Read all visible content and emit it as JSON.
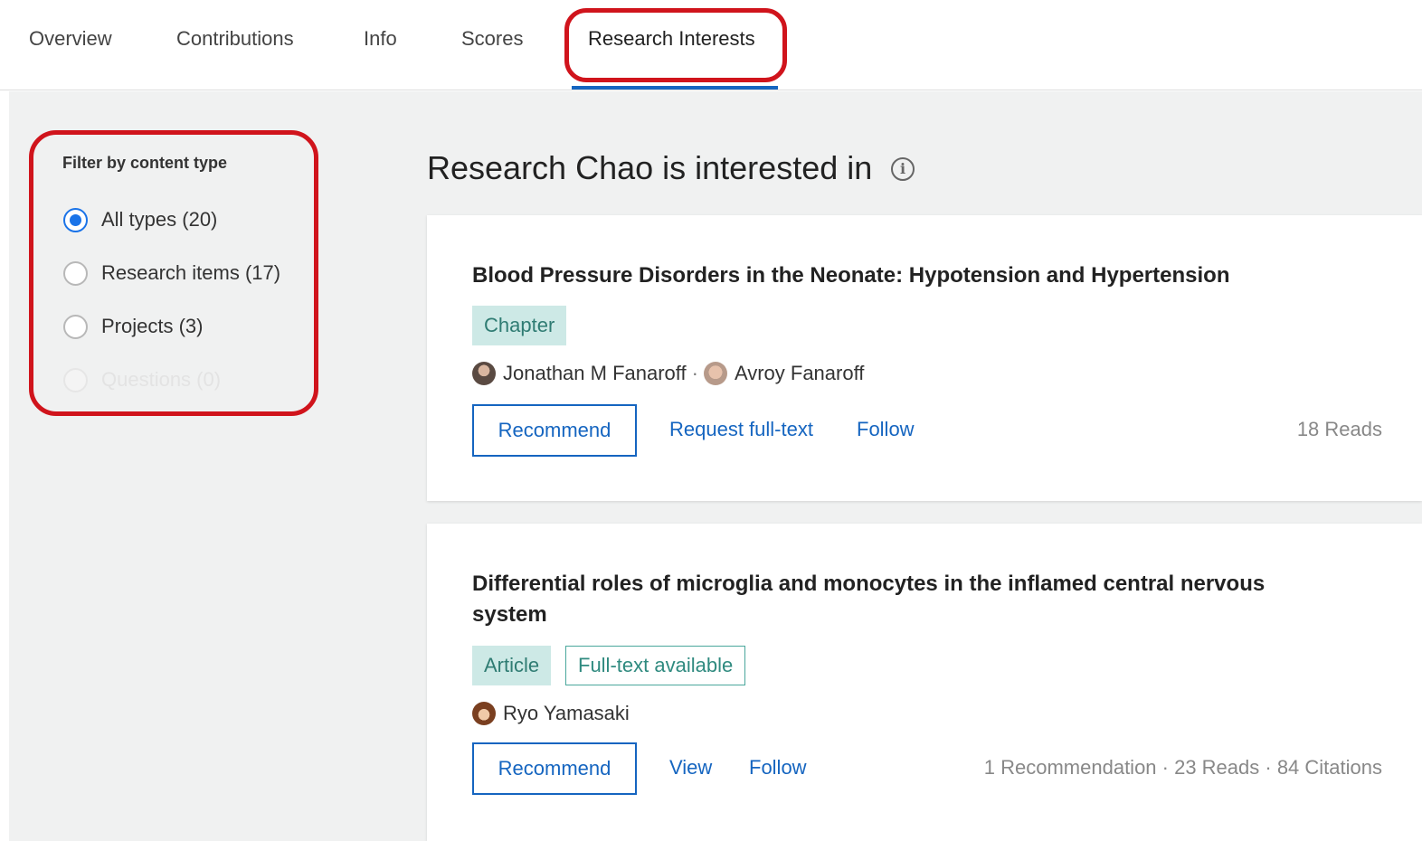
{
  "tabs": [
    {
      "label": "Overview"
    },
    {
      "label": "Contributions"
    },
    {
      "label": "Info"
    },
    {
      "label": "Scores"
    },
    {
      "label": "Research Interests"
    }
  ],
  "active_tab": "Research Interests",
  "accent_color": "#1565c0",
  "highlight_color": "#d0141c",
  "filter": {
    "heading": "Filter by content type",
    "options": [
      {
        "label": "All types (20)",
        "checked": true,
        "disabled": false
      },
      {
        "label": "Research items (17)",
        "checked": false,
        "disabled": false
      },
      {
        "label": "Projects (3)",
        "checked": false,
        "disabled": false
      },
      {
        "label": "Questions (0)",
        "checked": false,
        "disabled": true
      }
    ]
  },
  "section": {
    "title": "Research Chao is interested in",
    "info_icon": "info-icon"
  },
  "items": [
    {
      "title": "Blood Pressure Disorders in the Neonate: Hypotension and Hypertension",
      "type": "Chapter",
      "authors": [
        "Jonathan M Fanaroff",
        "Avroy Fanaroff"
      ],
      "author_separator": "·",
      "recommend_label": "Recommend",
      "actions": [
        "Request full-text",
        "Follow"
      ],
      "stats": "18 Reads"
    },
    {
      "title": "Differential roles of microglia and monocytes in the inflamed central nervous system",
      "type": "Article",
      "extra_badge": "Full-text available",
      "authors": [
        "Ryo Yamasaki"
      ],
      "recommend_label": "Recommend",
      "actions": [
        "View",
        "Follow"
      ],
      "stats": "1 Recommendation · 23 Reads · 84 Citations"
    }
  ]
}
